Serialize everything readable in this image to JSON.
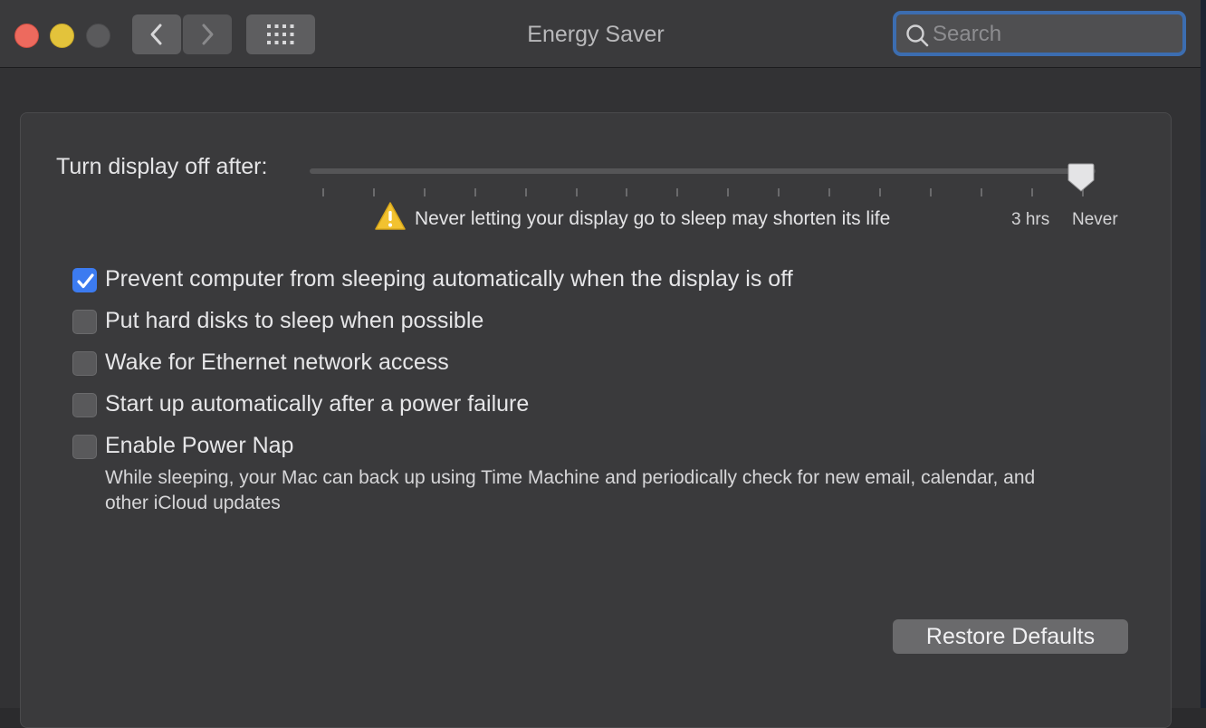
{
  "window": {
    "title": "Energy Saver"
  },
  "toolbar": {
    "back_icon": "chevron-left-icon",
    "forward_icon": "chevron-right-icon",
    "grid_icon": "show-all-grid-icon"
  },
  "search": {
    "placeholder": "Search",
    "value": ""
  },
  "display_sleep": {
    "label": "Turn display off after:",
    "selected": "Never",
    "warning": "Never letting your display go to sleep may shorten its life",
    "tick_labels": [
      "3 hrs",
      "Never"
    ]
  },
  "options": [
    {
      "label": "Prevent computer from sleeping automatically when the display is off",
      "checked": true
    },
    {
      "label": "Put hard disks to sleep when possible",
      "checked": false
    },
    {
      "label": "Wake for Ethernet network access",
      "checked": false
    },
    {
      "label": "Start up automatically after a power failure",
      "checked": false
    },
    {
      "label": "Enable Power Nap",
      "checked": false
    }
  ],
  "power_nap_description": "While sleeping, your Mac can back up using Time Machine and periodically check for new email, calendar, and other iCloud updates",
  "restore_button": "Restore Defaults",
  "colors": {
    "accent": "#3c7bf0",
    "close": "#ed6a5e",
    "minimize": "#e3c33b"
  }
}
